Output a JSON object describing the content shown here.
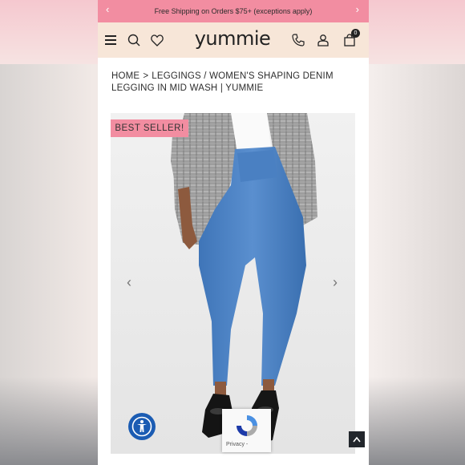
{
  "promo": {
    "text": "Free Shipping on Orders $75+ (exceptions apply)",
    "prev_icon": "chevron-left-icon",
    "next_icon": "chevron-right-icon"
  },
  "header": {
    "logo": "yummie",
    "cart_count": "0",
    "icons": [
      "menu-icon",
      "search-icon",
      "heart-icon",
      "phone-icon",
      "user-icon",
      "cart-icon"
    ]
  },
  "breadcrumb": {
    "home": "HOME",
    "separator": ">",
    "current": "LEGGINGS / WOMEN'S SHAPING DENIM LEGGING IN MID WASH | YUMMIE"
  },
  "product": {
    "badge": "BEST SELLER!",
    "prev_icon": "chevron-left-icon",
    "next_icon": "chevron-right-icon"
  },
  "recaptcha": {
    "label": "Privacy -"
  },
  "colors": {
    "promo_bg": "#f28da1",
    "header_bg": "#f7e6d8",
    "accessibility_bg": "#1b5cb3",
    "denim": "#4d82c4"
  }
}
